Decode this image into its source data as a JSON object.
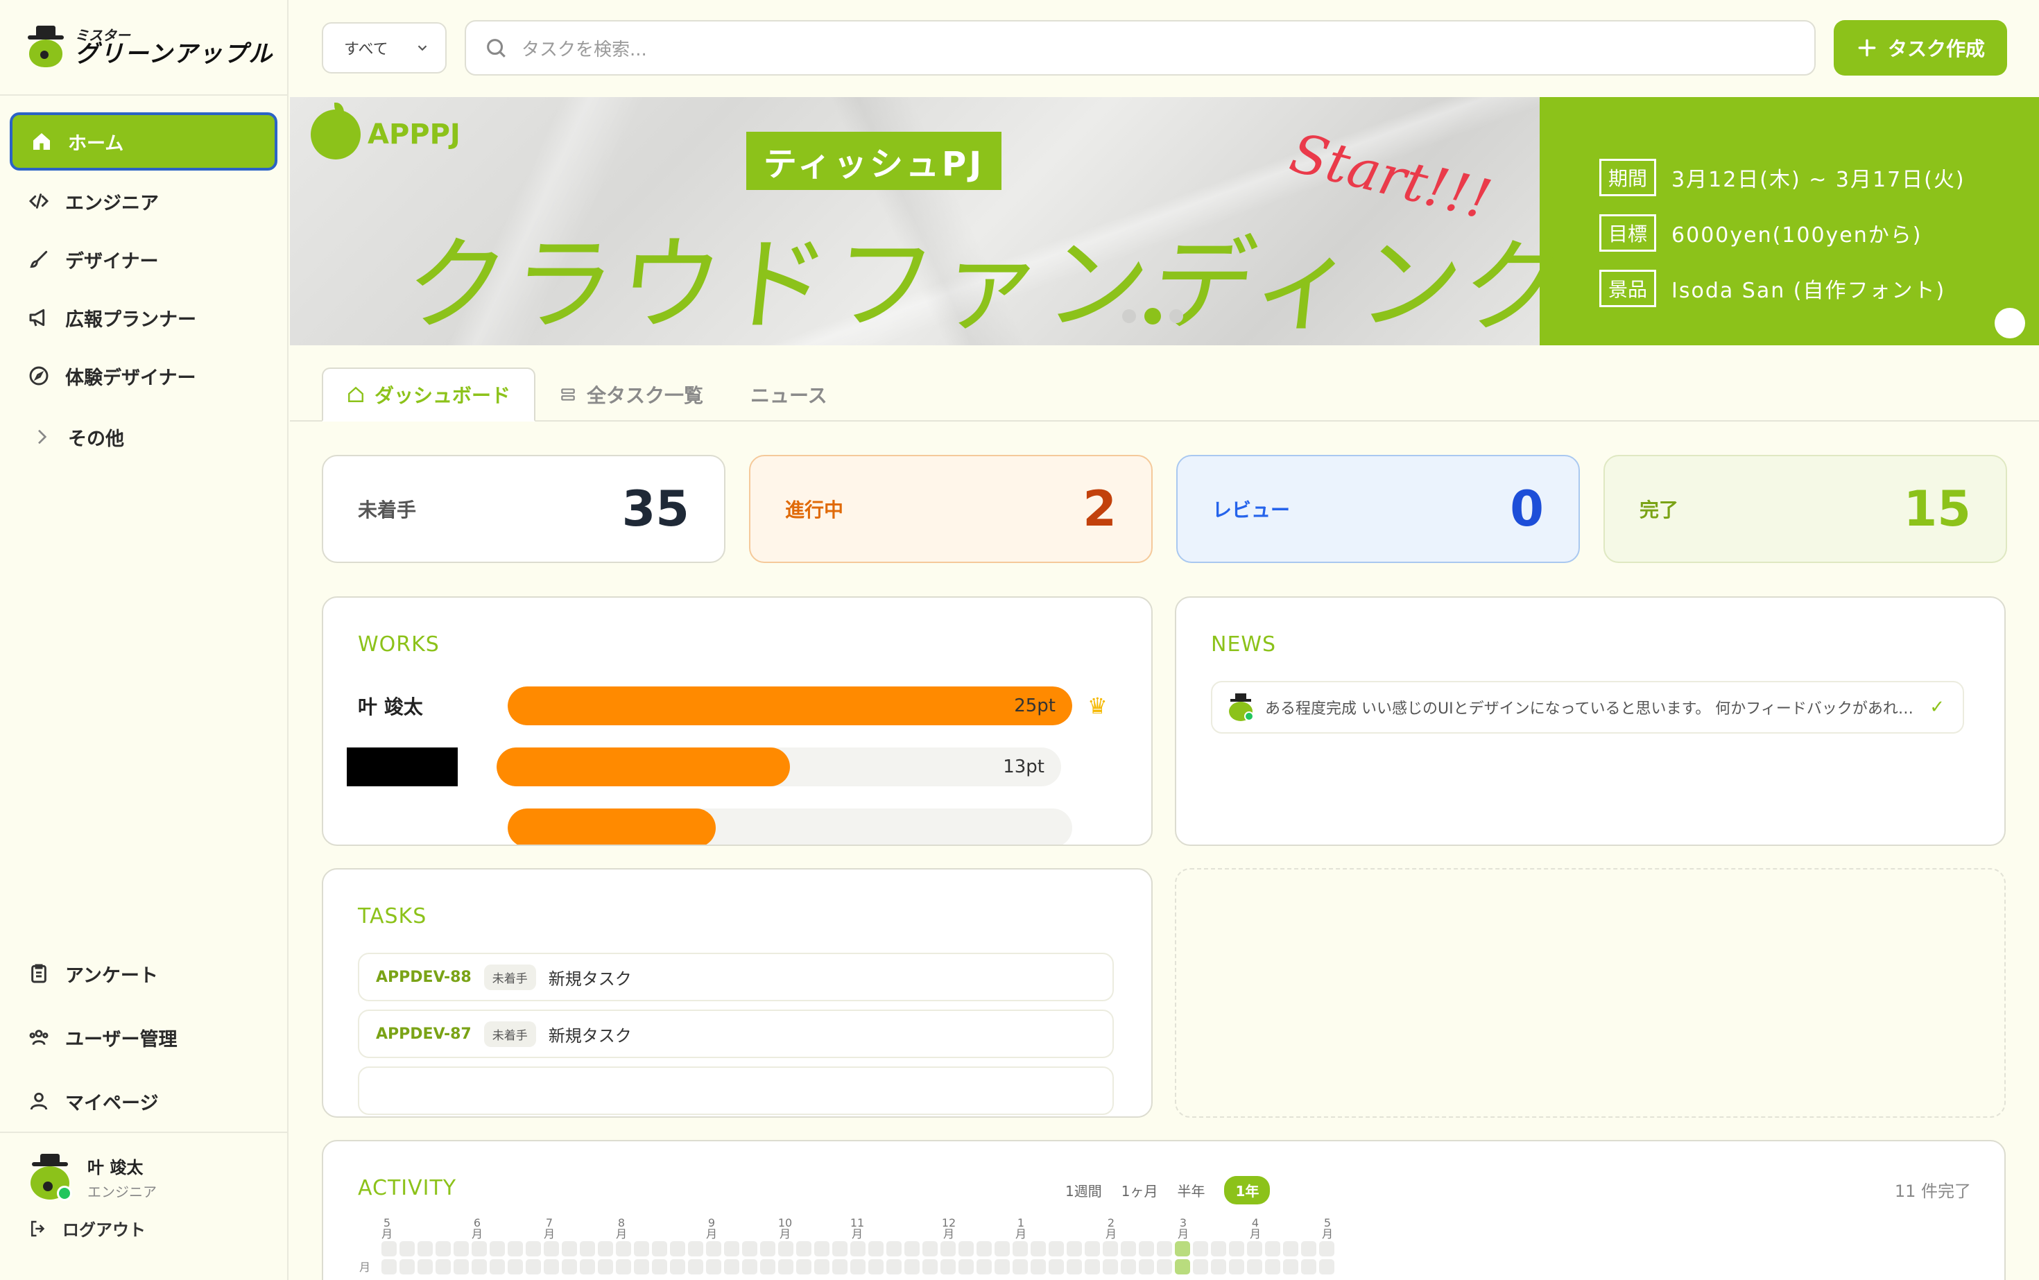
{
  "app": {
    "logo_small": "ミスター",
    "logo_big": "グリーンアップル"
  },
  "sidebar": {
    "items": [
      {
        "label": "ホーム",
        "icon": "home-icon",
        "active": true
      },
      {
        "label": "エンジニア",
        "icon": "code-icon"
      },
      {
        "label": "デザイナー",
        "icon": "brush-icon"
      },
      {
        "label": "広報プランナー",
        "icon": "megaphone-icon"
      },
      {
        "label": "体験デザイナー",
        "icon": "compass-icon"
      }
    ],
    "other_label": "その他",
    "bottom_items": [
      {
        "label": "アンケート",
        "icon": "clipboard-icon"
      },
      {
        "label": "ユーザー管理",
        "icon": "users-icon"
      },
      {
        "label": "マイページ",
        "icon": "user-icon"
      }
    ],
    "user": {
      "name": "叶 竣太",
      "role": "エンジニア"
    },
    "logout_label": "ログアウト"
  },
  "topbar": {
    "filter_value": "すべて",
    "search_placeholder": "タスクを検索...",
    "create_label": "タスク作成"
  },
  "banner": {
    "logo_text": "APPPJ",
    "pj_label": "ティッシュPJ",
    "title": "クラウドファンディング",
    "start_text": "Start!!!",
    "info": [
      {
        "key": "期間",
        "value": "3月12日(木) ~ 3月17日(火)"
      },
      {
        "key": "目標",
        "value": "6000yen(100yenから)"
      },
      {
        "key": "景品",
        "value": "Isoda San (自作フォント)"
      }
    ],
    "slides": 3,
    "active_slide": 2
  },
  "tabs": [
    {
      "label": "ダッシュボード",
      "icon": "home-icon",
      "active": true
    },
    {
      "label": "全タスク一覧",
      "icon": "list-icon"
    },
    {
      "label": "ニュース",
      "icon": ""
    }
  ],
  "stats": [
    {
      "label": "未着手",
      "value": "35"
    },
    {
      "label": "進行中",
      "value": "2"
    },
    {
      "label": "レビュー",
      "value": "0"
    },
    {
      "label": "完了",
      "value": "15"
    }
  ],
  "works": {
    "title": "WORKS",
    "max_points": 25,
    "rows": [
      {
        "name": "叶 竣太",
        "points": 25,
        "label": "25pt",
        "crown": true
      },
      {
        "name": "",
        "redacted": true,
        "points": 13,
        "label": "13pt"
      }
    ]
  },
  "news": {
    "title": "NEWS",
    "items": [
      {
        "text": "ある程度完成 いい感じのUIとデザインになっていると思います。 何かフィードバックがあれば..."
      }
    ]
  },
  "tasks": {
    "title": "TASKS",
    "items": [
      {
        "id": "APPDEV-88",
        "status": "未着手",
        "name": "新規タスク"
      },
      {
        "id": "APPDEV-87",
        "status": "未着手",
        "name": "新規タスク"
      }
    ]
  },
  "activity": {
    "title": "ACTIVITY",
    "periods": [
      "1週間",
      "1ヶ月",
      "半年",
      "1年"
    ],
    "active_period": "1年",
    "done_count": "11 件完了",
    "months": [
      "5月",
      "6月",
      "7月",
      "8月",
      "9月",
      "10月",
      "11月",
      "12月",
      "1月",
      "2月",
      "3月",
      "4月",
      "5月"
    ],
    "day_label": "月"
  },
  "colors": {
    "accent": "#8cc21a",
    "orange": "#ff8a00",
    "blue": "#1d4ed8",
    "highlight_border": "#2b63c6"
  }
}
